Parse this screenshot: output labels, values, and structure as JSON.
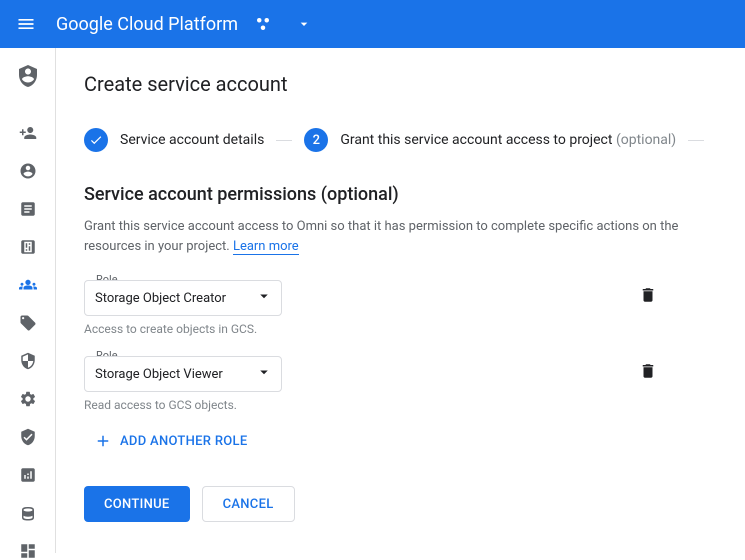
{
  "header": {
    "logo_text": "Google Cloud Platform"
  },
  "page": {
    "title": "Create service account"
  },
  "stepper": {
    "step1_label": "Service account details",
    "step2_number": "2",
    "step2_label": "Grant this service account access to project",
    "step2_optional": "(optional)"
  },
  "section": {
    "title": "Service account permissions (optional)",
    "desc_part1": "Grant this service account access to Omni so that it has permission to complete specific actions on the resources in your project. ",
    "learn_more": "Learn more"
  },
  "roles": [
    {
      "label": "Role",
      "value": "Storage Object Creator",
      "hint": "Access to create objects in GCS."
    },
    {
      "label": "Role",
      "value": "Storage Object Viewer",
      "hint": "Read access to GCS objects."
    }
  ],
  "add_role_label": "ADD ANOTHER ROLE",
  "buttons": {
    "continue": "CONTINUE",
    "cancel": "CANCEL"
  }
}
